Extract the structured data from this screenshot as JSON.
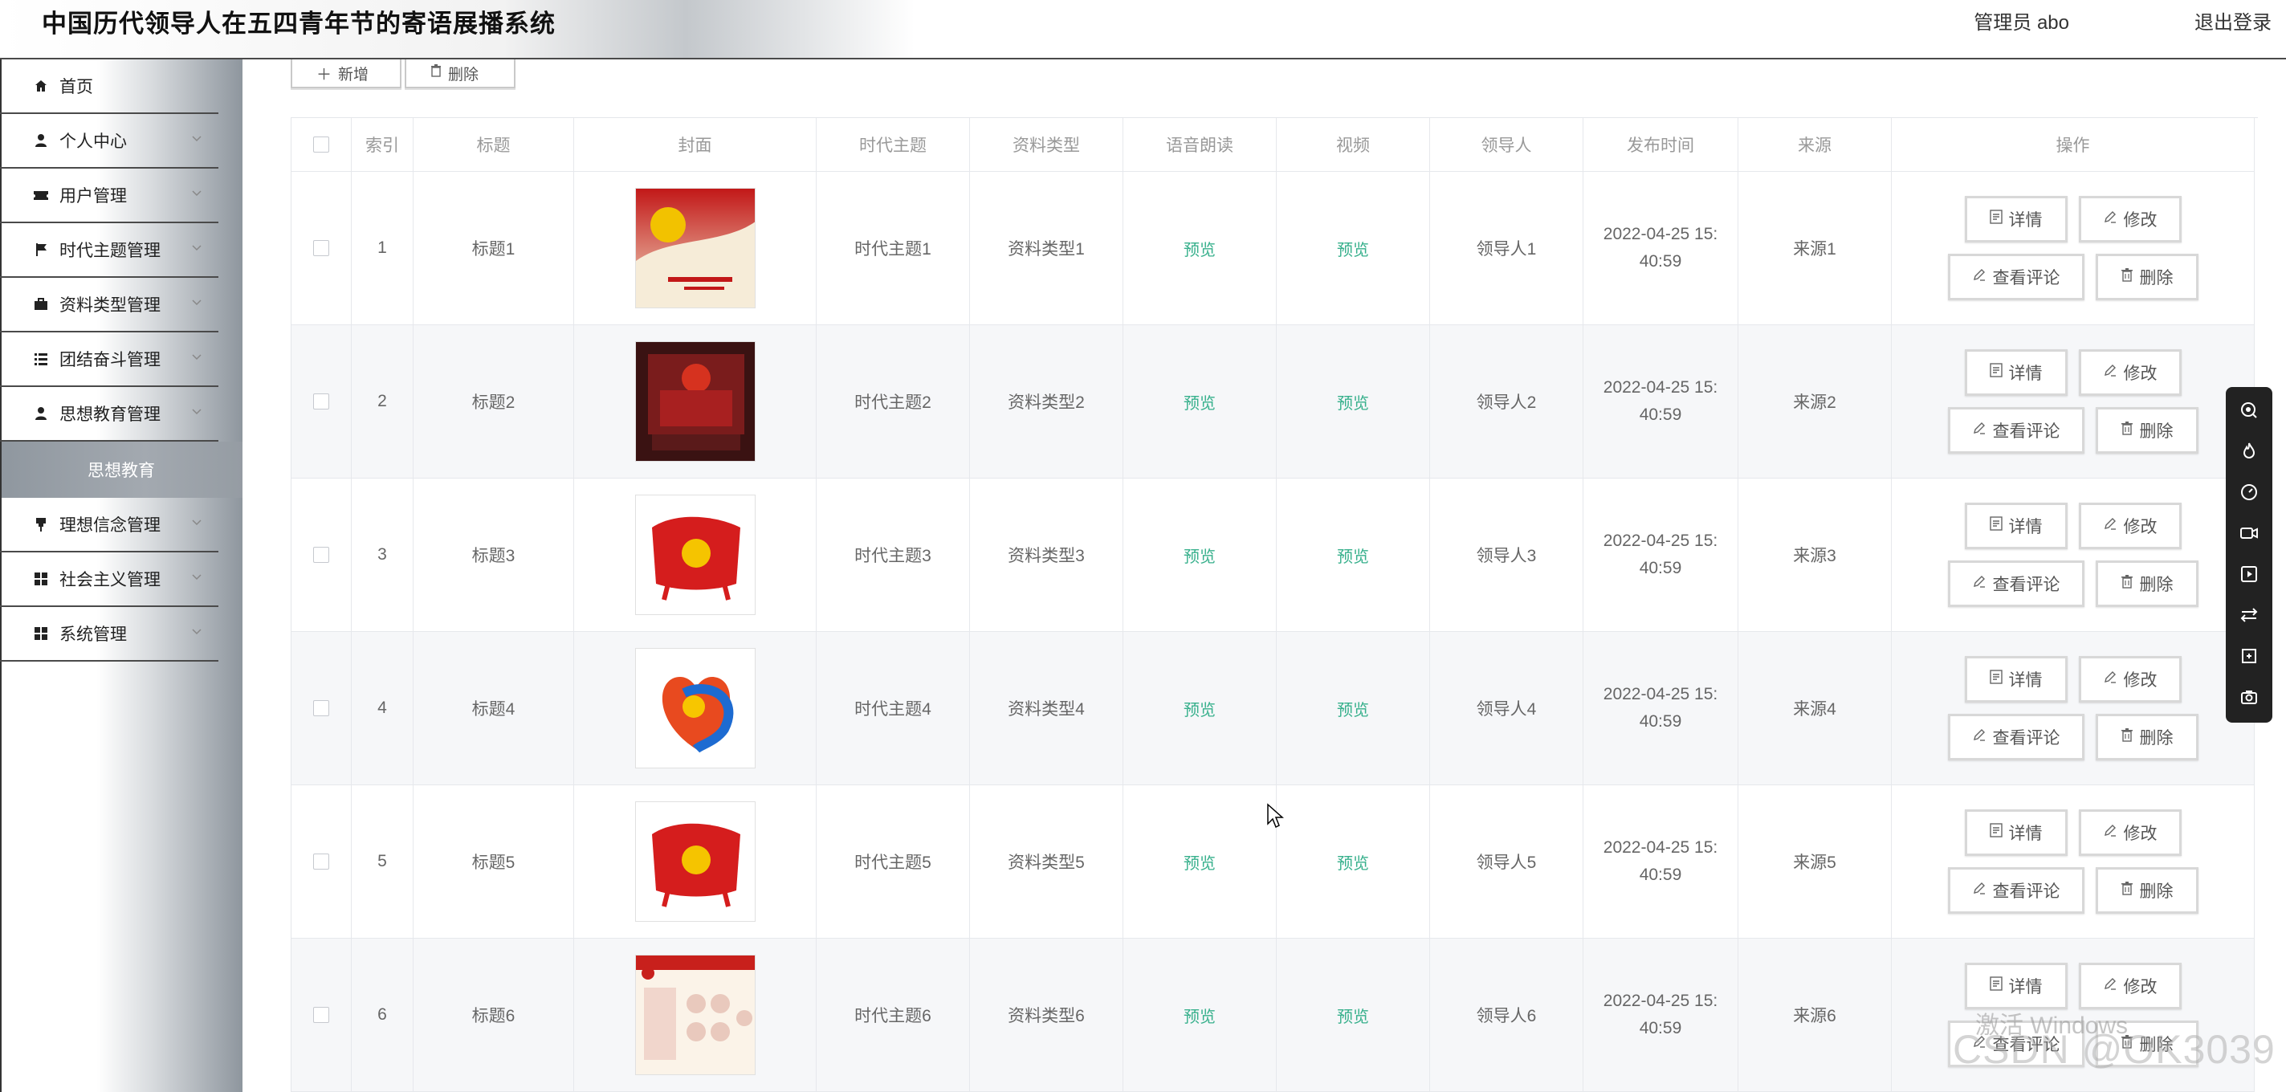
{
  "header": {
    "title": "中国历代领导人在五四青年节的寄语展播系统",
    "admin": "管理员 abo",
    "logout": "退出登录"
  },
  "sidebar": {
    "items": [
      {
        "label": "首页",
        "icon": "home-icon"
      },
      {
        "label": "个人中心",
        "icon": "user-icon"
      },
      {
        "label": "用户管理",
        "icon": "ticket-icon"
      },
      {
        "label": "时代主题管理",
        "icon": "flag-icon"
      },
      {
        "label": "资料类型管理",
        "icon": "briefcase-icon"
      },
      {
        "label": "团结奋斗管理",
        "icon": "list-icon"
      },
      {
        "label": "思想教育管理",
        "icon": "user-icon"
      },
      {
        "label": "理想信念管理",
        "icon": "pin-icon"
      },
      {
        "label": "社会主义管理",
        "icon": "grid-icon"
      },
      {
        "label": "系统管理",
        "icon": "grid-icon"
      }
    ],
    "active_sub": "思想教育"
  },
  "toolbar": {
    "add_label": "新增",
    "delete_label": "删除"
  },
  "table": {
    "headers": {
      "index": "索引",
      "title": "标题",
      "cover": "封面",
      "theme": "时代主题",
      "type": "资料类型",
      "audio": "语音朗读",
      "video": "视频",
      "leader": "领导人",
      "time": "发布时间",
      "source": "来源",
      "ops": "操作"
    },
    "rows": [
      {
        "index": "1",
        "title": "标题1",
        "theme": "时代主题1",
        "type": "资料类型1",
        "audio": "预览",
        "video": "预览",
        "leader": "领导人1",
        "time1": "2022-04-25 15:",
        "time2": "40:59",
        "source": "来源1"
      },
      {
        "index": "2",
        "title": "标题2",
        "theme": "时代主题2",
        "type": "资料类型2",
        "audio": "预览",
        "video": "预览",
        "leader": "领导人2",
        "time1": "2022-04-25 15:",
        "time2": "40:59",
        "source": "来源2"
      },
      {
        "index": "3",
        "title": "标题3",
        "theme": "时代主题3",
        "type": "资料类型3",
        "audio": "预览",
        "video": "预览",
        "leader": "领导人3",
        "time1": "2022-04-25 15:",
        "time2": "40:59",
        "source": "来源3"
      },
      {
        "index": "4",
        "title": "标题4",
        "theme": "时代主题4",
        "type": "资料类型4",
        "audio": "预览",
        "video": "预览",
        "leader": "领导人4",
        "time1": "2022-04-25 15:",
        "time2": "40:59",
        "source": "来源4"
      },
      {
        "index": "5",
        "title": "标题5",
        "theme": "时代主题5",
        "type": "资料类型5",
        "audio": "预览",
        "video": "预览",
        "leader": "领导人5",
        "time1": "2022-04-25 15:",
        "time2": "40:59",
        "source": "来源5"
      },
      {
        "index": "6",
        "title": "标题6",
        "theme": "时代主题6",
        "type": "资料类型6",
        "audio": "预览",
        "video": "预览",
        "leader": "领导人6",
        "time1": "2022-04-25 15:",
        "time2": "40:59",
        "source": "来源6"
      }
    ],
    "ops": {
      "detail": "详情",
      "edit": "修改",
      "comment": "查看评论",
      "delete": "删除"
    }
  },
  "watermark": {
    "activate": "激活 Windows",
    "csdn": "CSDN @OK3039"
  },
  "colors": {
    "accent": "#37b08c",
    "border": "#4a4a4a",
    "sidebar_active": "#9aa1a8",
    "float_bar": "#222222"
  }
}
